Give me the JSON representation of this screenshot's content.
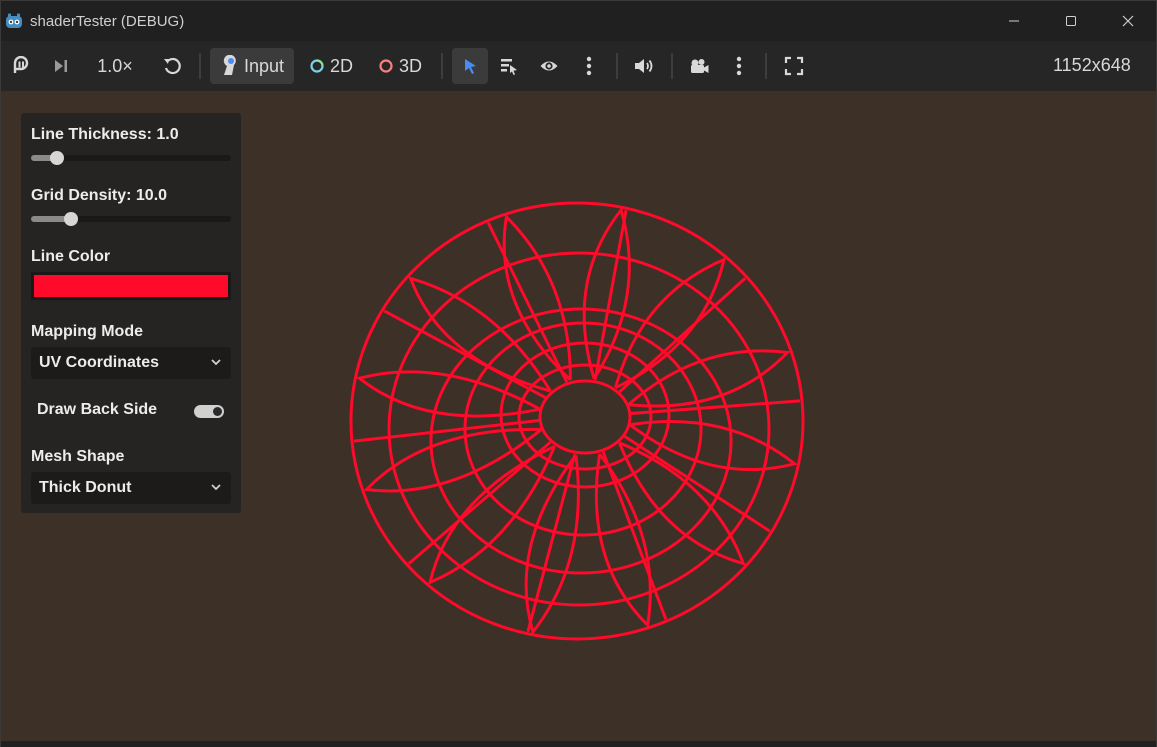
{
  "window": {
    "title": "shaderTester (DEBUG)"
  },
  "toolbar": {
    "speed_label": "1.0×",
    "input_label": "Input",
    "mode_2d_label": "2D",
    "mode_3d_label": "3D",
    "resolution": "1152x648"
  },
  "panel": {
    "line_thickness": {
      "label": "Line Thickness: 1.0",
      "value": 1.0,
      "fraction": 0.13
    },
    "grid_density": {
      "label": "Grid Density: 10.0",
      "value": 10.0,
      "fraction": 0.2
    },
    "line_color": {
      "label": "Line Color",
      "value": "#ff0a2a"
    },
    "mapping_mode": {
      "label": "Mapping Mode",
      "selected": "UV Coordinates"
    },
    "draw_back_side": {
      "label": "Draw Back Side",
      "checked": true
    },
    "mesh_shape": {
      "label": "Mesh Shape",
      "selected": "Thick Donut"
    }
  },
  "colors": {
    "viewport_bg": "#3d3026",
    "wire": "#ff0a2a",
    "accent": "#4a8cf7"
  }
}
